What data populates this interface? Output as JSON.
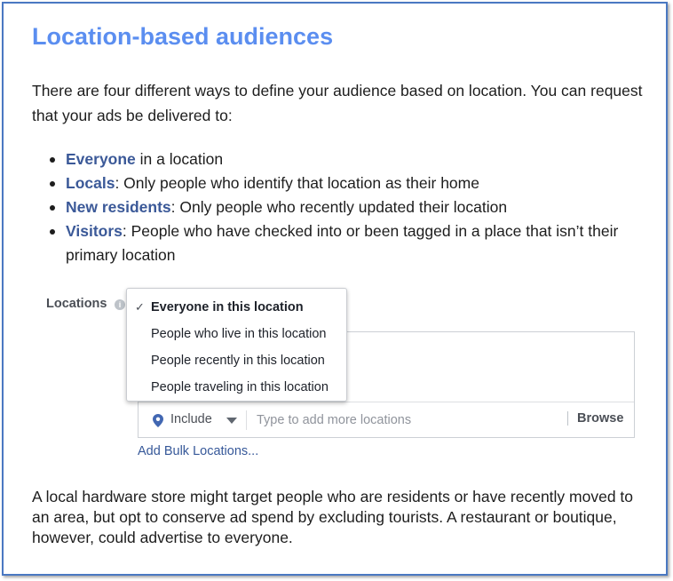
{
  "heading": "Location-based audiences",
  "intro": "There are four different ways to define your audience based on location. You can request that your ads be delivered to:",
  "bullets": [
    {
      "term": "Everyone",
      "rest": " in a location"
    },
    {
      "term": "Locals",
      "rest": ": Only people who identify that location as their home"
    },
    {
      "term": "New residents",
      "rest": ": Only people who recently updated their location"
    },
    {
      "term": "Visitors",
      "rest": ": People who have checked into or been tagged in a place that isn’t their primary location"
    }
  ],
  "widget": {
    "label": "Locations",
    "info_icon": "info-icon",
    "dropdown": {
      "options": [
        "Everyone in this location",
        "People who live in this location",
        "People recently in this location",
        "People traveling in this location"
      ],
      "selected_index": 0
    },
    "include_label": "Include",
    "input_placeholder": "Type to add more locations",
    "browse_label": "Browse",
    "bulk_link": "Add Bulk Locations..."
  },
  "outro": "A local hardware store might target people who are residents or have recently moved to an area, but opt to conserve ad spend by excluding tourists. A restaurant or boutique, however, could advertise to everyone.",
  "colors": {
    "heading": "#5b8ef0",
    "term": "#3b5998",
    "frame_border": "#4a78c2",
    "link": "#365899"
  }
}
